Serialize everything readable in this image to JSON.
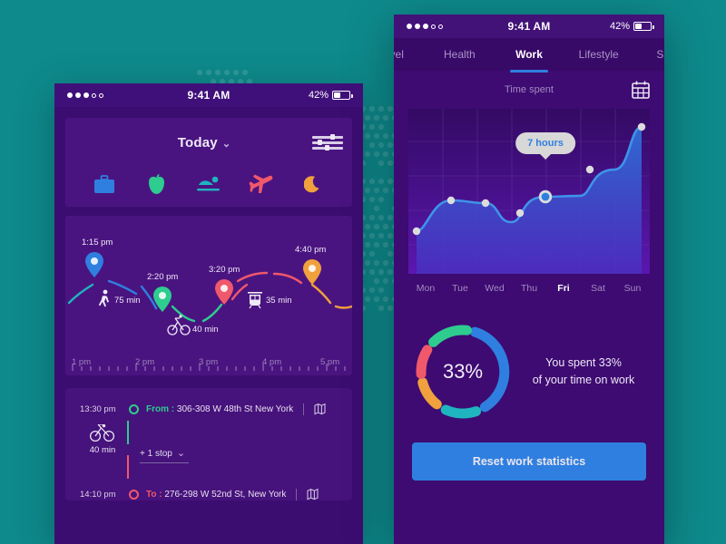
{
  "background": {
    "color": "#0e8a8c",
    "pattern": "dotted-world-map"
  },
  "left_phone": {
    "statusbar": {
      "time": "9:41 AM",
      "battery": "42%"
    },
    "header": {
      "title": "Today",
      "chevron": "⌄",
      "filter_icon": "filter-sliders-icon"
    },
    "categories": [
      {
        "name": "work",
        "icon": "briefcase-icon",
        "color": "#2f7fe0"
      },
      {
        "name": "health",
        "icon": "apple-icon",
        "color": "#2ecc8f"
      },
      {
        "name": "lifestyle",
        "icon": "swimmer-icon",
        "color": "#1fb5bf"
      },
      {
        "name": "travel",
        "icon": "airplane-icon",
        "color": "#f0586b"
      },
      {
        "name": "sleep",
        "icon": "moon-icon",
        "color": "#f0a03c"
      }
    ],
    "map": {
      "pins": [
        {
          "time": "1:15 pm",
          "color": "#2f7fe0"
        },
        {
          "time": "2:20 pm",
          "color": "#2ecc8f"
        },
        {
          "time": "3:20 pm",
          "color": "#f0586b"
        },
        {
          "time": "4:40 pm",
          "color": "#f0a03c"
        }
      ],
      "legs": [
        {
          "mode": "walk-icon",
          "duration": "75 min"
        },
        {
          "mode": "bike-icon",
          "duration": "40 min"
        },
        {
          "mode": "train-icon",
          "duration": "35 min"
        }
      ],
      "ruler": [
        "1 pm",
        "2 pm",
        "3 pm",
        "4 pm",
        "5 pm"
      ]
    },
    "route": {
      "from_time": "13:30 pm",
      "from_prefix": "From :",
      "from_address": "306-308 W 48th St New York",
      "to_time": "14:10 pm",
      "to_prefix": "To :",
      "to_address": "276-298 W 52nd St, New York",
      "leg_icon": "bike-icon",
      "leg_duration": "40 min",
      "stops_label": "+ 1 stop",
      "stops_chevron": "⌄",
      "map_icon": "map-icon"
    }
  },
  "right_phone": {
    "statusbar": {
      "time": "9:41 AM",
      "battery": "42%"
    },
    "tabs": [
      {
        "label": "Travel",
        "active": false,
        "clipped": "left"
      },
      {
        "label": "Health",
        "active": false
      },
      {
        "label": "Work",
        "active": true
      },
      {
        "label": "Lifestyle",
        "active": false
      },
      {
        "label": "Sleep",
        "active": false,
        "clipped": "right"
      }
    ],
    "section": {
      "title": "Time spent",
      "calendar_icon": "calendar-icon"
    },
    "tooltip": "7 hours",
    "summary": {
      "percent": "33%",
      "text_line1": "You spent 33%",
      "text_line2": "of your time on work"
    },
    "reset_button": "Reset work statistics",
    "colors": {
      "accent": "#2f7fe0",
      "green": "#2ecc8f",
      "teal": "#1fb5bf",
      "orange": "#f0a03c",
      "red": "#f0586b"
    }
  },
  "chart_data": {
    "type": "area",
    "title": "Time spent",
    "categories": [
      "Mon",
      "Tue",
      "Wed",
      "Thu",
      "Fri",
      "Sat",
      "Sun"
    ],
    "values": [
      2.6,
      5.2,
      5.0,
      5.6,
      7.0,
      7.9,
      9.6
    ],
    "ylabel": "hours",
    "xlabel": "",
    "ylim": [
      0,
      10
    ],
    "highlight": {
      "category": "Fri",
      "value": 7,
      "label": "7 hours"
    },
    "grid": true,
    "legend": "none"
  },
  "donut_data": {
    "type": "pie",
    "title": "33%",
    "segments": [
      {
        "name": "work",
        "value": 33,
        "color": "#2f7fe0"
      },
      {
        "name": "lifestyle",
        "value": 16,
        "color": "#1fb5bf"
      },
      {
        "name": "sleep",
        "value": 16,
        "color": "#f0a03c"
      },
      {
        "name": "travel",
        "value": 16,
        "color": "#f0586b"
      },
      {
        "name": "health",
        "value": 19,
        "color": "#2ecc8f"
      }
    ]
  }
}
